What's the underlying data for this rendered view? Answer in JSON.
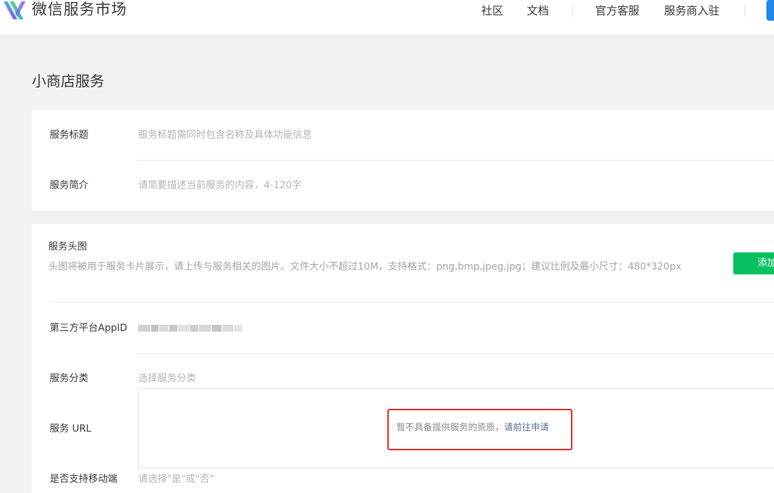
{
  "header": {
    "brand": "微信服务市场",
    "nav": [
      {
        "label": "社区"
      },
      {
        "label": "文档"
      },
      {
        "label": "官方客服"
      },
      {
        "label": "服务商入驻"
      }
    ]
  },
  "page": {
    "title": "小商店服务"
  },
  "form_basic": {
    "service_title": {
      "label": "服务标题",
      "placeholder": "服务标题需同时包含名称及具体功能信息"
    },
    "service_intro": {
      "label": "服务简介",
      "placeholder": "请简要描述当前服务的内容，4-120字"
    }
  },
  "form_detail": {
    "header_image": {
      "label": "服务头图",
      "hint": "头图将被用于服务卡片展示，请上传与服务相关的图片。文件大小不超过10M，支持格式：png,bmp,jpeg,jpg；建议比例及最小尺寸：480*320px",
      "add_button": "添加"
    },
    "appid": {
      "label": "第三方平台AppID"
    },
    "category": {
      "label": "服务分类",
      "placeholder": "选择服务分类"
    },
    "url": {
      "label": "服务 URL"
    },
    "mobile": {
      "label": "是否支持移动端",
      "placeholder": "请选择\"是\"或\"否\""
    },
    "notice": {
      "text": "暂不具备提供服务的资质，",
      "link": "请前往申请"
    }
  },
  "colors": {
    "primary_green": "#07c160",
    "link_blue": "#576b95",
    "highlight_red": "#e5231a",
    "background": "#f2f2f2"
  }
}
